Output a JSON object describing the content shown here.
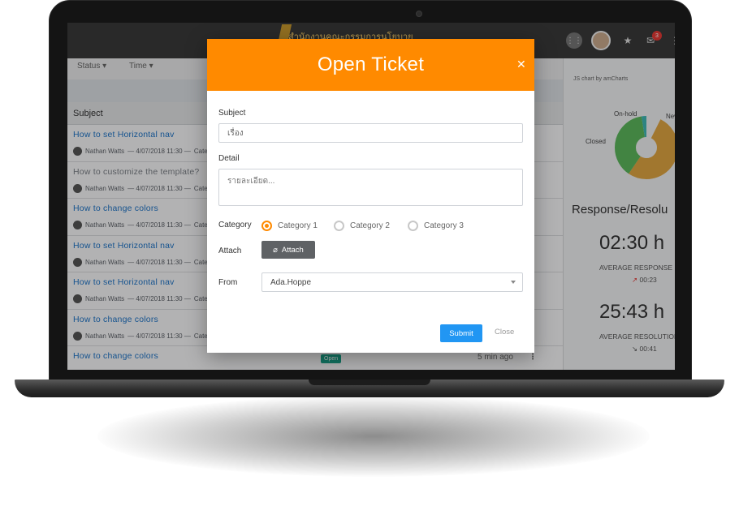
{
  "topbar": {
    "brand_text": "สำนักงานคณะกรรมการนโยบาย",
    "notification_count": "3"
  },
  "filters": {
    "status": "Status",
    "time": "Time"
  },
  "table": {
    "column_subject": "Subject",
    "rows": [
      {
        "title": "How to set Horizontal nav",
        "author": "Nathan Watts",
        "date": "— 4/07/2018 11:30 —",
        "cat": "Categ",
        "muted": false
      },
      {
        "title": "How to customize the template?",
        "author": "Nathan Watts",
        "date": "— 4/07/2018 11:30 —",
        "cat": "Categ",
        "muted": true
      },
      {
        "title": "How to change colors",
        "author": "Nathan Watts",
        "date": "— 4/07/2018 11:30 —",
        "cat": "Categ",
        "muted": false
      },
      {
        "title": "How to set Horizontal nav",
        "author": "Nathan Watts",
        "date": "— 4/07/2018 11:30 —",
        "cat": "Categ",
        "muted": false
      },
      {
        "title": "How to set Horizontal nav",
        "author": "Nathan Watts",
        "date": "— 4/07/2018 11:30 —",
        "cat": "Categ",
        "muted": false
      },
      {
        "title": "How to change colors",
        "author": "Nathan Watts",
        "date": "— 4/07/2018 11:30 —",
        "cat": "Categ",
        "muted": false
      },
      {
        "title": "How to change colors",
        "author": "",
        "date": "",
        "cat": "",
        "muted": false
      }
    ],
    "last_row_badge": "Open",
    "last_row_time": "5 min ago"
  },
  "right_panel": {
    "chart_caption": "JS chart by amCharts",
    "chart_labels": {
      "on_hold": "On-hold",
      "new": "New",
      "closed": "Closed"
    },
    "response_title": "Response/Resolu",
    "avg_response_time": "02:30 h",
    "avg_response_label": "AVERAGE RESPONSE",
    "avg_response_delta": "00:23",
    "avg_resolution_time": "25:43 h",
    "avg_resolution_label": "AVERAGE RESOLUTION",
    "avg_resolution_delta": "00:41"
  },
  "modal": {
    "title": "Open Ticket",
    "subject_label": "Subject",
    "subject_value": "เรื่อง",
    "detail_label": "Detail",
    "detail_placeholder": "รายละเอียด...",
    "category_label": "Category",
    "categories": [
      "Category 1",
      "Category 2",
      "Category 3"
    ],
    "selected_category": "Category 1",
    "attach_label": "Attach",
    "attach_button": "Attach",
    "from_label": "From",
    "from_value": "Ada.Hoppe",
    "submit_button": "Submit",
    "close_button": "Close"
  },
  "colors": {
    "accent": "#ff8a00",
    "primary": "#2196f3",
    "link": "#1e73c6",
    "donut_green": "#5cb85c",
    "donut_orange": "#e0a642",
    "donut_teal": "#3fb7b5"
  }
}
